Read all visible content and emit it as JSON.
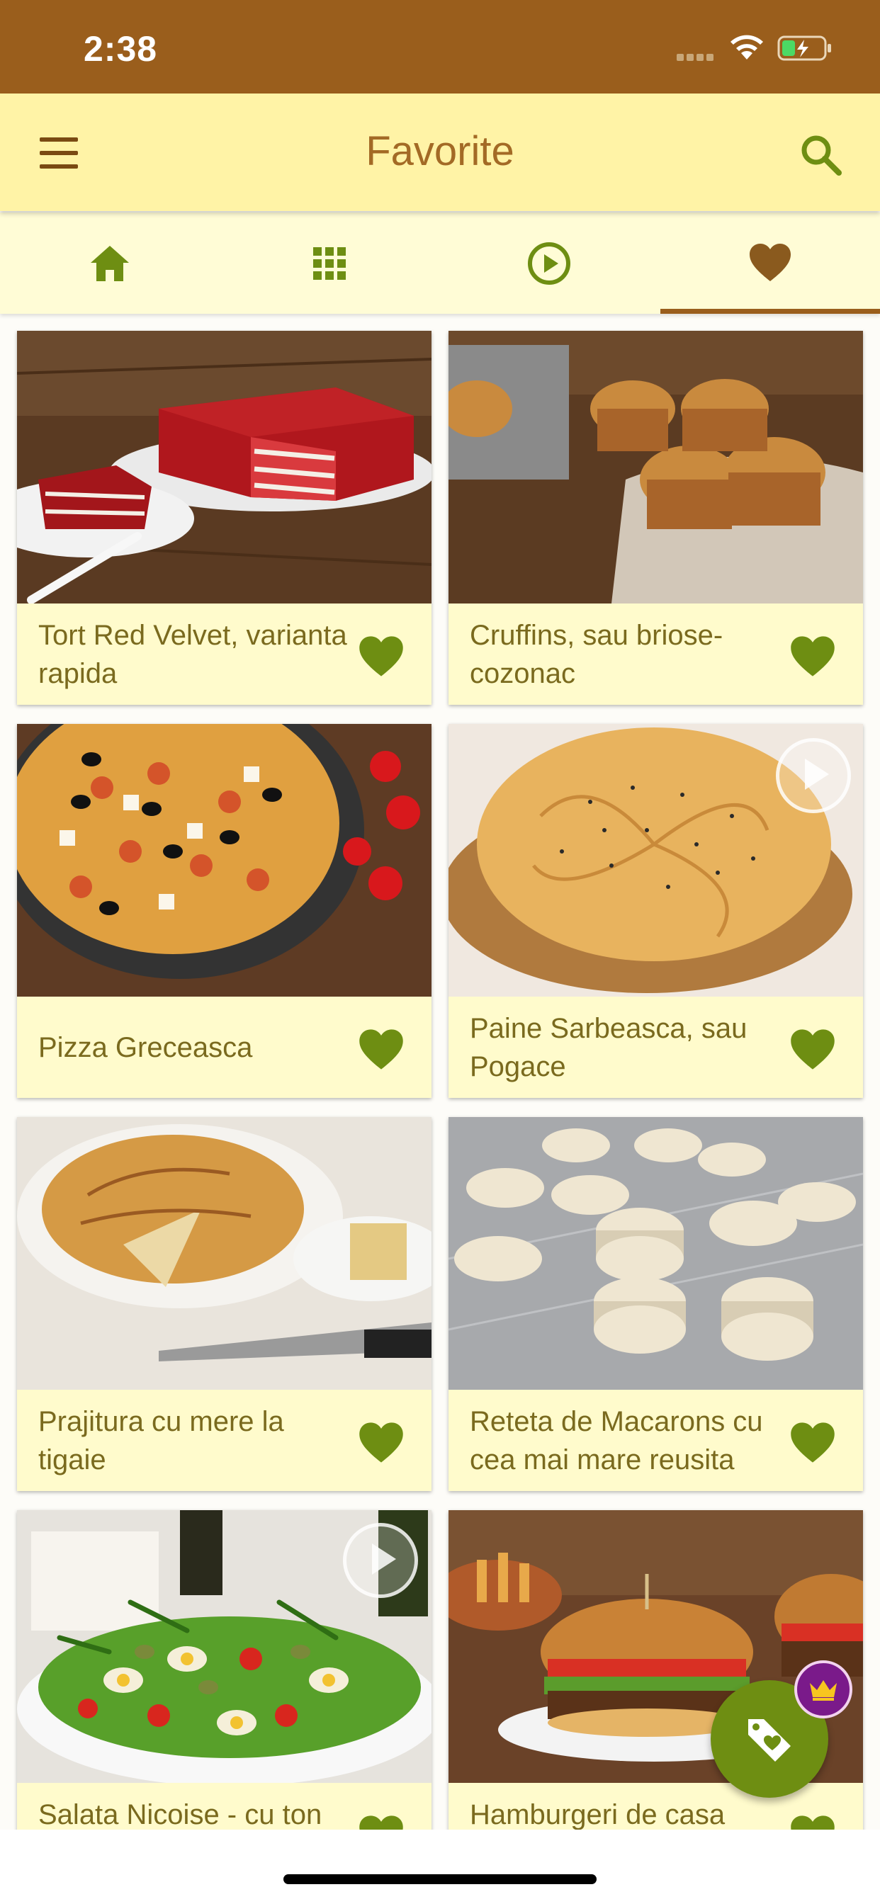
{
  "status_bar": {
    "time": "2:38"
  },
  "app_bar": {
    "title": "Favorite",
    "menu_icon": "hamburger-menu-icon",
    "search_icon": "search-icon"
  },
  "tabs": [
    {
      "icon": "home-icon",
      "active": false
    },
    {
      "icon": "grid-icon",
      "active": false
    },
    {
      "icon": "play-circle-icon",
      "active": false
    },
    {
      "icon": "heart-icon",
      "active": true
    }
  ],
  "recipes": [
    {
      "title": "Tort Red Velvet, varianta rapida",
      "favorite": true,
      "video": false
    },
    {
      "title": "Cruffins, sau briose-cozonac",
      "favorite": true,
      "video": false
    },
    {
      "title": "Pizza Greceasca",
      "favorite": true,
      "video": false
    },
    {
      "title": "Paine Sarbeasca, sau Pogace",
      "favorite": true,
      "video": true
    },
    {
      "title": "Prajitura cu mere la tigaie",
      "favorite": true,
      "video": false
    },
    {
      "title": "Reteta de Macarons cu cea mai mare reusita",
      "favorite": true,
      "video": false
    },
    {
      "title": "Salata Nicoise - cu ton",
      "favorite": true,
      "video": true
    },
    {
      "title": "Hamburgeri de casa",
      "favorite": true,
      "video": false
    }
  ],
  "fab": {
    "icon": "tag-heart-icon",
    "badge_icon": "crown-icon"
  },
  "colors": {
    "status_bar": "#9a5e1c",
    "app_bar": "#fff3a6",
    "accent_green": "#6e8e12",
    "title_brown": "#a36a25",
    "card_bg": "#fffbcc"
  }
}
